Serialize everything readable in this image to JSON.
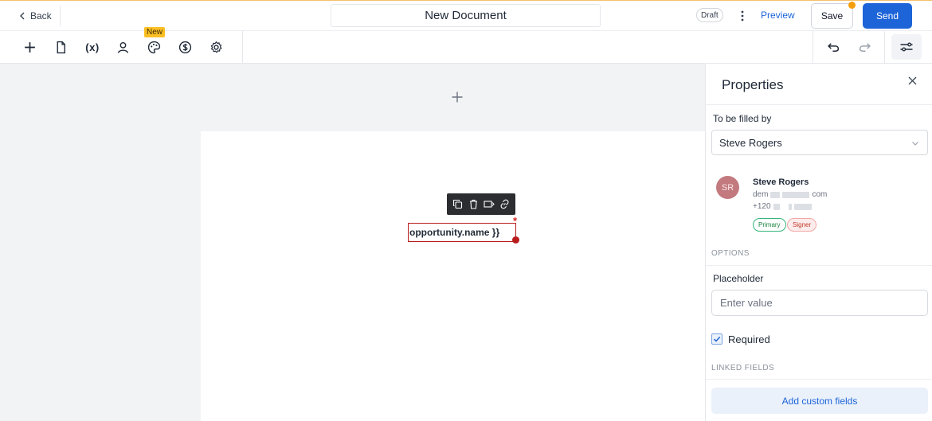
{
  "header": {
    "back_label": "Back",
    "document_title": "New Document",
    "status_badge": "Draft",
    "preview_label": "Preview",
    "save_label": "Save",
    "send_label": "Send"
  },
  "toolbar": {
    "variables_label": "(x)",
    "new_badge": "New"
  },
  "editor": {
    "field_text": "opportunity.name }}",
    "required_marker": "*"
  },
  "properties": {
    "title": "Properties",
    "filled_by_label": "To be filled by",
    "filled_by_value": "Steve Rogers",
    "recipient": {
      "initials": "SR",
      "name": "Steve Rogers",
      "email_start": "dem",
      "email_end": "com",
      "phone_start": "+120",
      "tags": [
        "Primary",
        "Signer"
      ]
    },
    "options_heading": "OPTIONS",
    "placeholder_label": "Placeholder",
    "placeholder_input_placeholder": "Enter value",
    "required_label": "Required",
    "required_checked": true,
    "linked_fields_heading": "LINKED FIELDS",
    "add_custom_fields_label": "Add custom fields"
  },
  "colors": {
    "accent": "#1d64d8",
    "field_border": "#b91c1c",
    "badge_new": "#fbbf24",
    "save_dot": "#f59e0b"
  }
}
